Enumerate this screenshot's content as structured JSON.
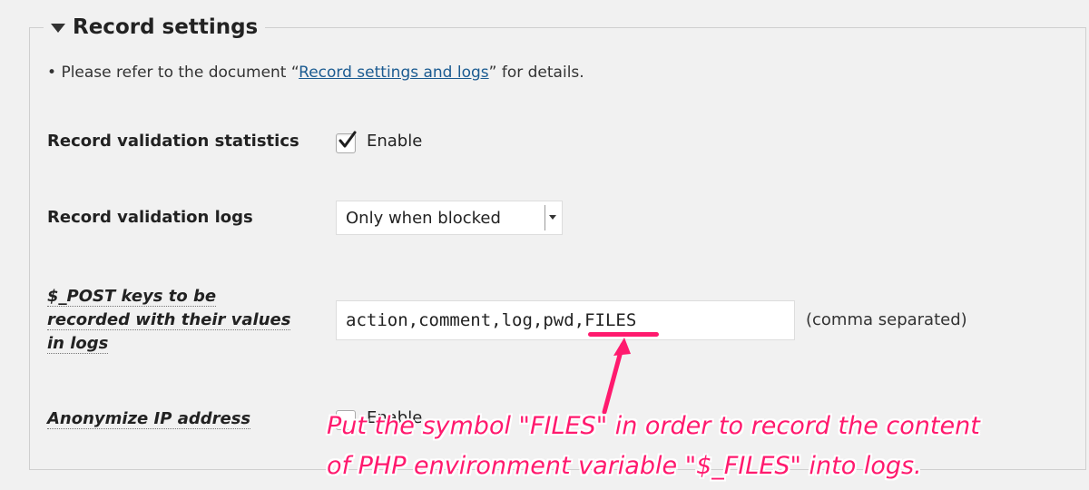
{
  "section": {
    "title": "Record settings"
  },
  "note": {
    "prefix": "Please refer to the document “",
    "link": "Record settings and logs",
    "suffix": "” for details."
  },
  "fields": {
    "validation_statistics": {
      "label": "Record validation statistics",
      "checkbox_label": "Enable",
      "checked": true
    },
    "validation_logs": {
      "label": "Record validation logs",
      "selected": "Only when blocked"
    },
    "post_keys": {
      "label_line1": "$_POST keys to be",
      "label_line2": "recorded with their values",
      "label_line3": "in logs",
      "value": "action,comment,log,pwd,FILES",
      "hint": "(comma separated)"
    },
    "anonymize_ip": {
      "label": "Anonymize IP address",
      "checkbox_label": "Enable"
    }
  },
  "annotation": {
    "line1": "Put the symbol \"FILES\" in order to record the content",
    "line2": "of PHP environment variable \"$_FILES\" into logs.",
    "color": "#ff1a6e"
  }
}
